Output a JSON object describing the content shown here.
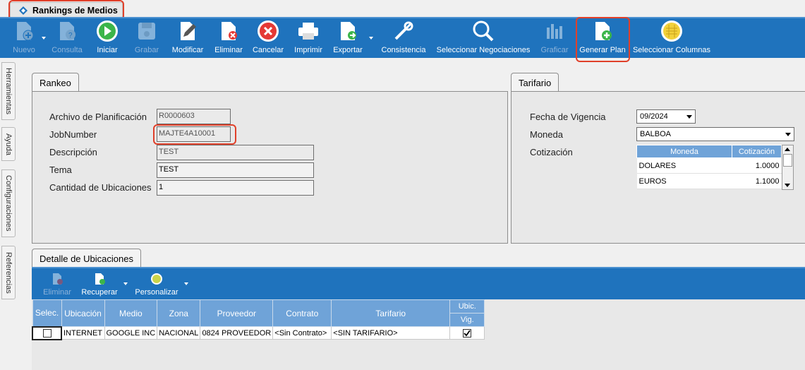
{
  "window_tab": {
    "title": "Rankings de Medios"
  },
  "toolbar": {
    "nuevo": "Nuevo",
    "consulta": "Consulta",
    "iniciar": "Iniciar",
    "grabar": "Grabar",
    "modificar": "Modificar",
    "eliminar": "Eliminar",
    "cancelar": "Cancelar",
    "imprimir": "Imprimir",
    "exportar": "Exportar",
    "consistencia": "Consistencia",
    "seleccionar_negociaciones": "Seleccionar Negociaciones",
    "graficar": "Graficar",
    "generar_plan": "Generar Plan",
    "seleccionar_columnas": "Seleccionar Columnas"
  },
  "side_tabs": [
    "Herramientas",
    "Ayuda",
    "Configuraciones",
    "Referencias"
  ],
  "rankeo": {
    "tab": "Rankeo",
    "archivo_label": "Archivo de Planificación",
    "archivo_value": "R0000603",
    "jobnumber_label": "JobNumber",
    "jobnumber_value": "MAJTE4A10001",
    "descripcion_label": "Descripción",
    "descripcion_value": "TEST",
    "tema_label": "Tema",
    "tema_value": "TEST",
    "cantidad_label": "Cantidad de Ubicaciones",
    "cantidad_value": "1"
  },
  "tarifario": {
    "tab": "Tarifario",
    "fecha_label": "Fecha de Vigencia",
    "fecha_value": "09/2024",
    "moneda_label": "Moneda",
    "moneda_value": "BALBOA",
    "cotizacion_label": "Cotización",
    "cot_headers": [
      "Moneda",
      "Cotización"
    ],
    "cot_rows": [
      {
        "moneda": "DOLARES",
        "cotizacion": "1.0000"
      },
      {
        "moneda": "EUROS",
        "cotizacion": "1.1000"
      }
    ]
  },
  "detalle": {
    "tab": "Detalle de Ubicaciones",
    "toolbar": {
      "eliminar": "Eliminar",
      "recuperar": "Recuperar",
      "personalizar": "Personalizar"
    },
    "headers": [
      "Selec.",
      "Ubicación",
      "Medio",
      "Zona",
      "Proveedor",
      "Contrato",
      "Tarifario",
      "Ubic.",
      "Vig."
    ],
    "rows": [
      {
        "ubicacion": "INTERNET",
        "medio": "GOOGLE INC",
        "zona": "NACIONAL",
        "proveedor": "0824 PROVEEDOR",
        "contrato": "<Sin Contrato>",
        "tarifario": "<SIN TARIFARIO>"
      }
    ]
  },
  "colors": {
    "toolbar_bg": "#1f73bd",
    "header_bg": "#6fa3d8",
    "highlight": "#e0402a"
  }
}
